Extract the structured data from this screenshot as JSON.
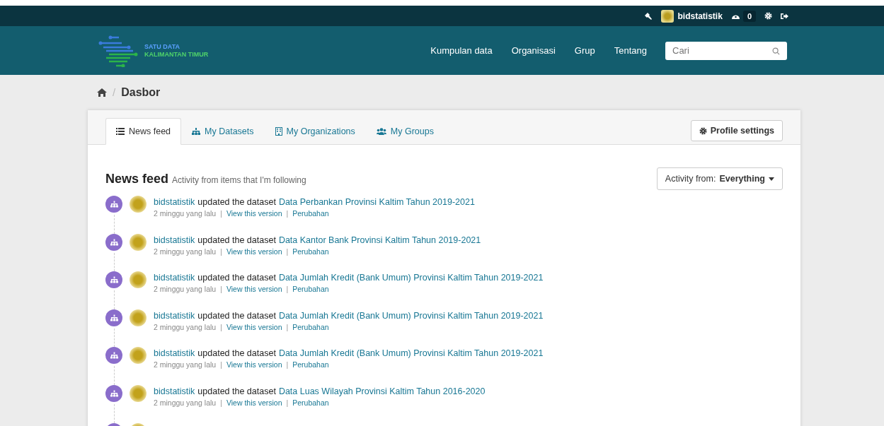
{
  "account_bar": {
    "username": "bidstatistik",
    "dashboard_count": "0"
  },
  "header": {
    "logo_line_1": "SATU DATA",
    "logo_line_2": "KALIMANTAN TIMUR",
    "nav": [
      {
        "label": "Kumpulan data"
      },
      {
        "label": "Organisasi"
      },
      {
        "label": "Grup"
      },
      {
        "label": "Tentang"
      }
    ],
    "search": {
      "placeholder": "Cari"
    }
  },
  "breadcrumb": {
    "separator": "/",
    "current": "Dasbor"
  },
  "tabs": [
    {
      "label": "News feed",
      "selected": true
    },
    {
      "label": "My Datasets",
      "selected": false
    },
    {
      "label": "My Organizations",
      "selected": false
    },
    {
      "label": "My Groups",
      "selected": false
    }
  ],
  "profile_button": "Profile settings",
  "feed": {
    "title": "News feed",
    "subtitle": "Activity from items that I'm following",
    "filter_label": "Activity from:",
    "filter_value": "Everything",
    "items": [
      {
        "actor": "bidstatistik",
        "action": "updated the dataset",
        "dataset": "Data Perbankan Provinsi Kaltim Tahun 2019-2021",
        "time": "2 minggu yang lalu",
        "sep1": "|",
        "view": "View this version",
        "sep2": "|",
        "changes": "Perubahan"
      },
      {
        "actor": "bidstatistik",
        "action": "updated the dataset",
        "dataset": "Data Kantor Bank Provinsi Kaltim Tahun 2019-2021",
        "time": "2 minggu yang lalu",
        "sep1": "|",
        "view": "View this version",
        "sep2": "|",
        "changes": "Perubahan"
      },
      {
        "actor": "bidstatistik",
        "action": "updated the dataset",
        "dataset": "Data Jumlah Kredit (Bank Umum) Provinsi Kaltim Tahun 2019-2021",
        "time": "2 minggu yang lalu",
        "sep1": "|",
        "view": "View this version",
        "sep2": "|",
        "changes": "Perubahan"
      },
      {
        "actor": "bidstatistik",
        "action": "updated the dataset",
        "dataset": "Data Jumlah Kredit (Bank Umum) Provinsi Kaltim Tahun 2019-2021",
        "time": "2 minggu yang lalu",
        "sep1": "|",
        "view": "View this version",
        "sep2": "|",
        "changes": "Perubahan"
      },
      {
        "actor": "bidstatistik",
        "action": "updated the dataset",
        "dataset": "Data Jumlah Kredit (Bank Umum) Provinsi Kaltim Tahun 2019-2021",
        "time": "2 minggu yang lalu",
        "sep1": "|",
        "view": "View this version",
        "sep2": "|",
        "changes": "Perubahan"
      },
      {
        "actor": "bidstatistik",
        "action": "updated the dataset",
        "dataset": "Data Luas Wilayah Provinsi Kaltim Tahun 2016-2020",
        "time": "2 minggu yang lalu",
        "sep1": "|",
        "view": "View this version",
        "sep2": "|",
        "changes": "Perubahan"
      }
    ]
  }
}
